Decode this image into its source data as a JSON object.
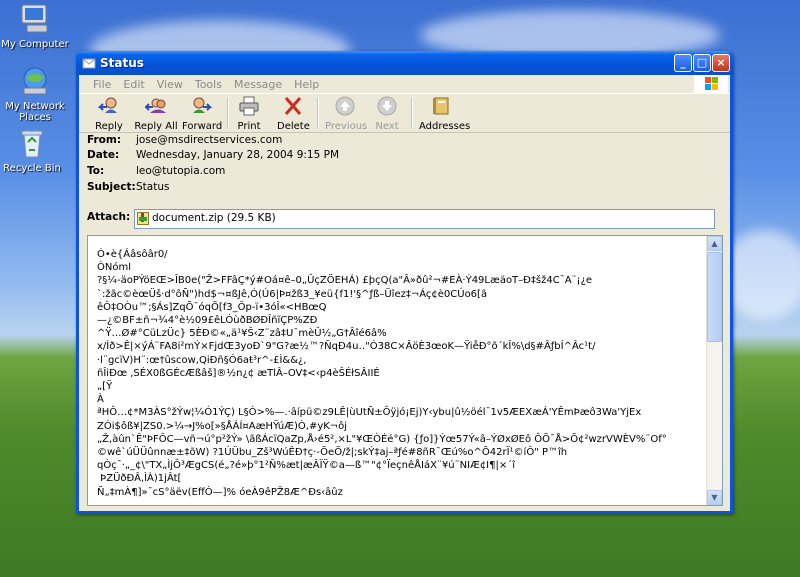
{
  "desktop": {
    "icons": [
      {
        "label": "My Computer"
      },
      {
        "label": "My Network Places"
      },
      {
        "label": "Recycle Bin"
      }
    ]
  },
  "window": {
    "title": "Status",
    "menu": [
      "File",
      "Edit",
      "View",
      "Tools",
      "Message",
      "Help"
    ],
    "toolbar": {
      "reply": "Reply",
      "reply_all": "Reply All",
      "forward": "Forward",
      "print": "Print",
      "delete": "Delete",
      "previous": "Previous",
      "next": "Next",
      "addresses": "Addresses"
    },
    "header": {
      "from_label": "From:",
      "from": "jose@msdirectservices.com",
      "date_label": "Date:",
      "date": "Wednesday, January 28, 2004 9:15 PM",
      "to_label": "To:",
      "to": "leo@tutopia.com",
      "subject_label": "Subject:",
      "subject": "Status",
      "attach_label": "Attach:",
      "attachment": "document.zip (29.5 KB)"
    },
    "body_lines": [
      "Ó•è{Áâsôâr0/",
      "ÒNóml",
      "?§¼-äoPÝöEŒ>ÎB0e(\"Ž>FFâÇ*ý#Oá¤ê–0„ÛçZÖEHÁ) £þçQ(a\"Â»ðû²¬#EÀ·Ý49LæäoT–Ð‡šž4C¯A¨¡¿e",
      "`:žãc©èœÜš·d°ôÑ\")hd$¬¤ßJê,Ó(Ú6|Þ¤žß3_¥eü{f1!'§^ƒß–Üîez‡¬Áç¢è0CÚo6[ã",
      "êÔ‡OÒu™;§Ás]ZqÕ¯óqÕ[f3_Ôp-ï•3óÎ«<HBœQ",
      "—¿©BF±ñ¬¾4°è½09£êLÓùðBØĐÎñĩÇP%ZÐ",
      "^Ÿ…Ø#°CüLzÜc} 5ÈÐ©«„ä¹¥Š‹Z¨zâ‡U¯mèÛ½„G†Âîé6â%",
      "x/Ìð>Ê|×ýÁ¨FA8i²mÝ×FjdŒ3yoÐ`9\"G?æ½™?ÑqÐ4u‥\"Ó38C×ÂöÈ3œoK—ŸiễÐ°õ´kÎ%\\d§#ÂƒbÍ^Âc¹t/",
      "·l¨gcïV)H¨:œ†ûscow,QiĐñ§Ó6aŧ³r^-£Ì&&¿,",
      "ñÎiÐœ ,SÉX0ßGÉcÆßâš]®½n¿¢ æTlÂ–OV‡<‹p4èŠÉłSÂIIÉ",
      "„[Ÿ",
      "À",
      "ªHÔ…¢*M3ÀS°žÝw¦¼Ó1ÝÇ) L§Ó>%—.·âípü©z9LÊ|ùUtÑ±Ôÿjó¡Ej)Y‹ybu|û½öél¯1v5ÆEXæÁ'YÊmÞæô3Wa'YjEx",
      "ZÓi$ôß¥|ZS0.>¼→J%o[»§ÅÁÍ¤AæHŸúÆ)Ò,#yK¬ôj",
      "„Ž,àûn`Ê\"ÞFÔC—vñ¬ú°p²žÝ» \\ãßÁcïQaZp,Å›é5²,×L\"¥ŒÒÉé°G) {ƒo]}Ýœ57Ý«â–ÝØxØEô ÔÕ¯Å>Õ¢²wzrVWÈV%¨Of°",
      "©wê`úÜÜûnnæ±‡õW) ?1ÚÜbu_Zš³WúÊÐ†ç·-ÕeÕ/ž|;skÝ‡aj–ªƒé#8ñR¯Œú%o^Õ42rÏ¹©íÔ\" P™îh",
      "qÒç¯·„_¢\\\"TX„ÌjÔ³ÆgCS(é„?é»þ°1²Ñ%æt|æÂÏŸ©a—ß™\"¢°ÏeçnêÅIáX¨¥ú˜NIÆ¢I¶|×´î",
      " ÞZÜðÐÂ,ÌÀ)1jÂt[",
      "Ñ„‡mÀ¶]»¯cS°äëv(EffÒ—]% óeÀ9êPŽ8Æ^Ðs‹âûz"
    ]
  }
}
